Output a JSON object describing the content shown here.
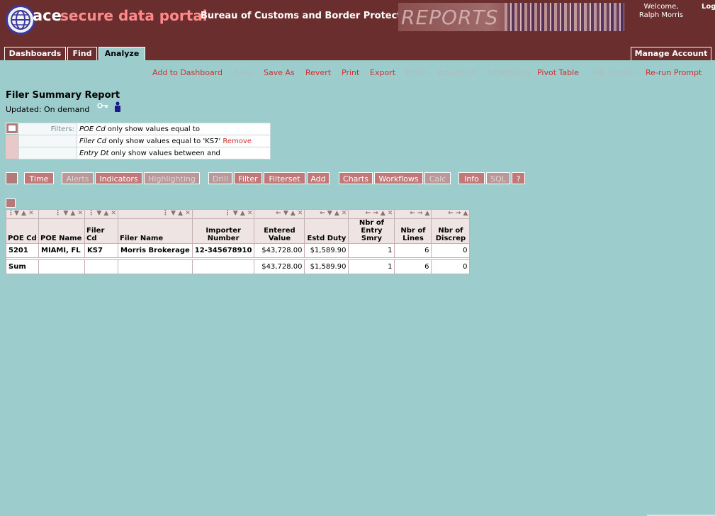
{
  "header": {
    "logo_ace": "ace",
    "logo_title": "secure data portal",
    "agency": "Bureau of Customs and Border Protection",
    "reports_banner": "REPORTS",
    "welcome": "Welcome, Ralph Morris",
    "logout": "Log"
  },
  "tabs": {
    "dashboards": "Dashboards",
    "find": "Find",
    "analyze": "Analyze",
    "manage_account": "Manage Account"
  },
  "actions": {
    "add_to_dashboard": "Add to Dashboard",
    "save": "Save",
    "save_as": "Save As",
    "revert": "Revert",
    "print": "Print",
    "export": "Export",
    "email": "Email",
    "broadcast": "Broadcast",
    "scheduling": "Scheduling",
    "pivot_table": "Pivot Table",
    "full_screen": "Full Screen",
    "rerun_prompt": "Re-run Prompt"
  },
  "report": {
    "title": "Filer Summary Report",
    "updated": "Updated: On demand"
  },
  "filters": {
    "label": "Filters:",
    "rows": [
      {
        "field": "POE Cd",
        "text": " only show values equal to",
        "remove": ""
      },
      {
        "field": "Filer Cd",
        "text": " only show values equal to 'KS7' ",
        "remove": "Remove"
      },
      {
        "field": "Entry Dt",
        "text": " only show values between and",
        "remove": ""
      }
    ]
  },
  "toolbar": {
    "time": "Time",
    "alerts": "Alerts",
    "indicators": "Indicators",
    "highlighting": "Highlighting",
    "drill": "Drill",
    "filter": "Filter",
    "filterset": "Filterset",
    "add": "Add",
    "charts": "Charts",
    "workflows": "Workflows",
    "calc": "Calc",
    "info": "Info",
    "sql": "SQL",
    "help": "?"
  },
  "table": {
    "headers": {
      "poe_cd": "POE Cd",
      "poe_name": "POE Name",
      "filer_cd": "Filer Cd",
      "filer_name": "Filer Name",
      "importer_number": "Importer Number",
      "entered_value": "Entered Value",
      "estd_duty": "Estd Duty",
      "nbr_entry_smry": "Nbr of Entry Smry",
      "nbr_lines": "Nbr of Lines",
      "nbr_discrep": "Nbr of Discrep"
    },
    "row": {
      "poe_cd": "5201",
      "poe_name": "MIAMI, FL",
      "filer_cd": "KS7",
      "filer_name": "Morris Brokerage",
      "importer_number": "12-345678910",
      "entered_value": "$43,728.00",
      "estd_duty": "$1,589.90",
      "nbr_entry_smry": "1",
      "nbr_lines": "6",
      "nbr_discrep": "0"
    },
    "sum": {
      "label": "Sum",
      "entered_value": "$43,728.00",
      "estd_duty": "$1,589.90",
      "nbr_entry_smry": "1",
      "nbr_lines": "6",
      "nbr_discrep": "0"
    }
  }
}
